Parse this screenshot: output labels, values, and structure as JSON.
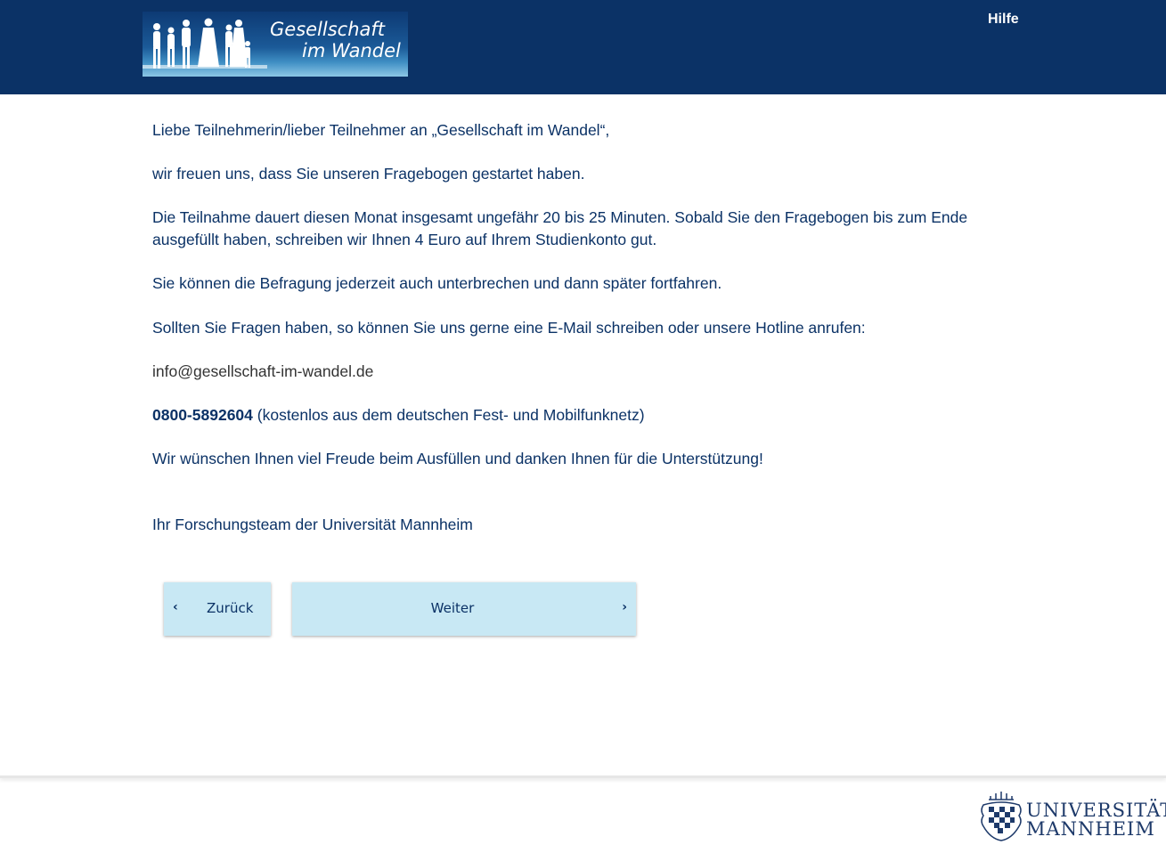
{
  "header": {
    "logo_line1": "Gesellschaft",
    "logo_line2": "im Wandel",
    "help_label": "Hilfe"
  },
  "content": {
    "greeting": "Liebe Teilnehmerin/lieber Teilnehmer an „Gesellschaft im Wandel“,",
    "intro": "wir freuen uns, dass Sie unseren Fragebogen gestartet haben.",
    "duration": "Die Teilnahme dauert diesen Monat insgesamt ungefähr 20 bis 25 Minuten. Sobald Sie den Fragebogen bis zum Ende ausgefüllt haben, schreiben wir Ihnen 4 Euro auf Ihrem Studienkonto gut.",
    "pause": "Sie können die Befragung jederzeit auch unterbrechen und dann später fortfahren.",
    "contact": "Sollten Sie Fragen haben, so können Sie uns gerne eine E-Mail schreiben oder unsere Hotline anrufen:",
    "email": "info@gesellschaft-im-wandel.de",
    "hotline_number": "0800-5892604",
    "hotline_note": " (kostenlos aus dem deutschen Fest- und Mobilfunknetz)",
    "thanks": "Wir wünschen Ihnen viel Freude beim Ausfüllen und danken Ihnen für die Unterstützung!",
    "signature": "Ihr Forschungsteam der Universität Mannheim"
  },
  "navigation": {
    "back_label": "Zurück",
    "next_label": "Weiter",
    "back_icon": "chevron-left-icon",
    "next_icon": "chevron-right-icon"
  },
  "footer": {
    "uni_line1": "UNIVERSITÄT",
    "uni_line2": "MANNHEIM"
  },
  "colors": {
    "header_bg": "#0b3266",
    "text": "#0b3266",
    "button_bg": "#c8e8f4"
  }
}
